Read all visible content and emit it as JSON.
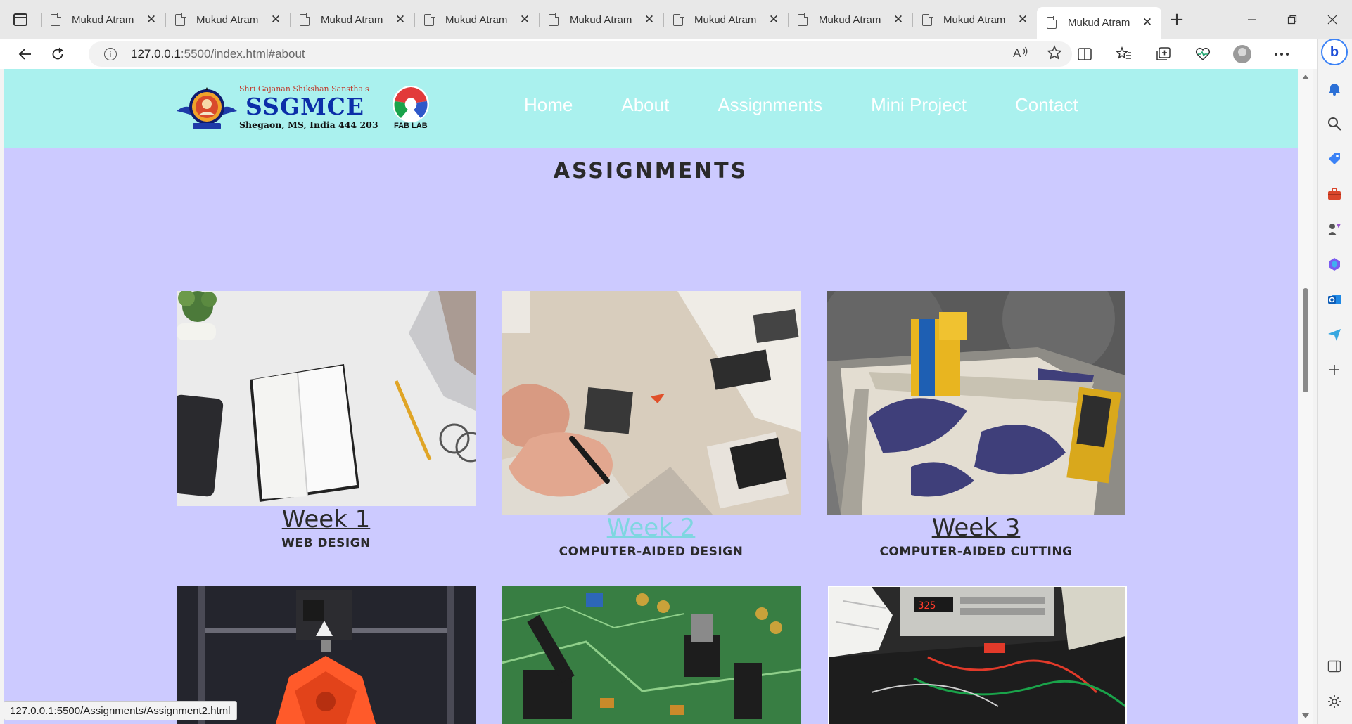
{
  "browser": {
    "tabs": [
      {
        "title": "Mukud Atram"
      },
      {
        "title": "Mukud Atram"
      },
      {
        "title": "Mukud Atram"
      },
      {
        "title": "Mukud Atram"
      },
      {
        "title": "Mukud Atram"
      },
      {
        "title": "Mukud Atram"
      },
      {
        "title": "Mukud Atram"
      },
      {
        "title": "Mukud Atram"
      },
      {
        "title": "Mukud Atram",
        "active": true
      }
    ],
    "tab_close_glyph": "✕",
    "new_tab_glyph": "+",
    "address": {
      "host": "127.0.0.1",
      "rest": ":5500/index.html#about"
    },
    "status_url": "127.0.0.1:5500/Assignments/Assignment2.html",
    "icons": {
      "back": "back-arrow-icon",
      "reload": "reload-icon",
      "info": "info-icon",
      "read_aloud": "read-aloud-icon",
      "favorite": "star-icon",
      "split_screen": "split-screen-icon",
      "favorites": "favorites-icon",
      "collections": "collections-icon",
      "browser_essentials": "heart-pulse-icon",
      "profile": "profile-avatar-icon",
      "more": "more-icon",
      "copilot": "copilot-icon"
    }
  },
  "site": {
    "logo": {
      "tagline": "Shri Gajanan Shikshan Sanstha's",
      "name": "SSGMCE",
      "place": "Shegaon, MS, India 444 203",
      "fablab_label": "FAB LAB"
    },
    "nav": [
      "Home",
      "About",
      "Assignments",
      "Mini Project",
      "Contact"
    ],
    "section_title": "ASSIGNMENTS",
    "assignments": [
      {
        "week": "Week 1",
        "subtitle": "WEB DESIGN",
        "image": "desk-notebook-photo"
      },
      {
        "week": "Week 2",
        "subtitle": "COMPUTER-AIDED DESIGN",
        "image": "drawing-hand-photo",
        "hovered": true
      },
      {
        "week": "Week 3",
        "subtitle": "COMPUTER-AIDED CUTTING",
        "image": "cnc-cutter-photo"
      },
      {
        "image": "3d-printer-photo"
      },
      {
        "image": "circuit-board-photo"
      },
      {
        "image": "electronics-lab-photo"
      }
    ]
  },
  "colors": {
    "page_background": "#cccaff",
    "header_background": "#aaf1ee",
    "nav_text": "#ffffff",
    "link_hover": "#7fd6e0",
    "text": "#2a2a2a"
  }
}
